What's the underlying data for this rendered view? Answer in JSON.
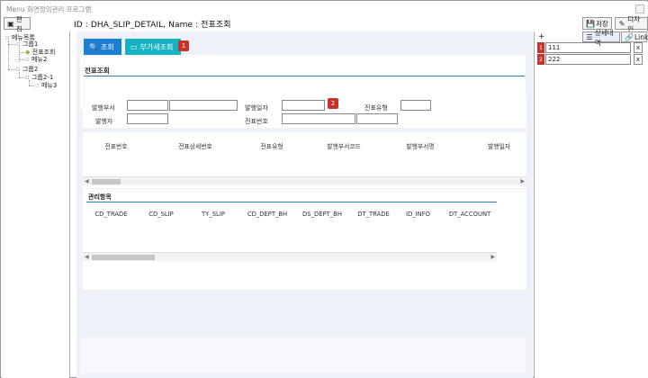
{
  "window": {
    "title": "Menu 화면정의관리 프로그램"
  },
  "toolbar": {
    "edit_label": "편집",
    "save_label": "저장",
    "design_label": "디자인"
  },
  "header": {
    "id_name": "ID : DHA_SLIP_DETAIL, Name : 전표조회"
  },
  "tree": {
    "root": "메뉴목록",
    "items": [
      "그룹1",
      "전표조회",
      "메뉴2",
      "그룹2",
      "그룹2-1",
      "메뉴3"
    ]
  },
  "actions": {
    "search_label": "조회",
    "vat_label": "부가세조회",
    "badge1": "1",
    "badge2": "2"
  },
  "section": {
    "title": "전표조회",
    "manage_title": "관리항목"
  },
  "form": {
    "issue_dept": "발행부서",
    "issue_date": "발행일자",
    "slip_type": "전표유형",
    "issuer": "발행자",
    "slip_no": "전표번호"
  },
  "grid1": {
    "headers": [
      "전표번호",
      "전표상세번호",
      "전표유형",
      "발행부서코드",
      "발행부서명",
      "발행일자"
    ]
  },
  "grid2": {
    "headers": [
      "CD_TRADE",
      "CD_SLIP",
      "TY_SLIP",
      "CD_DEPT_BH",
      "DS_DEPT_BH",
      "DT_TRADE",
      "ID_INFO",
      "DT_ACCOUNT"
    ]
  },
  "right": {
    "add_label": "+",
    "detail_label": "상세내역",
    "link_label": "Link",
    "rows": [
      {
        "num": "1",
        "value": "111"
      },
      {
        "num": "2",
        "value": "222"
      }
    ],
    "remove_label": "x"
  }
}
